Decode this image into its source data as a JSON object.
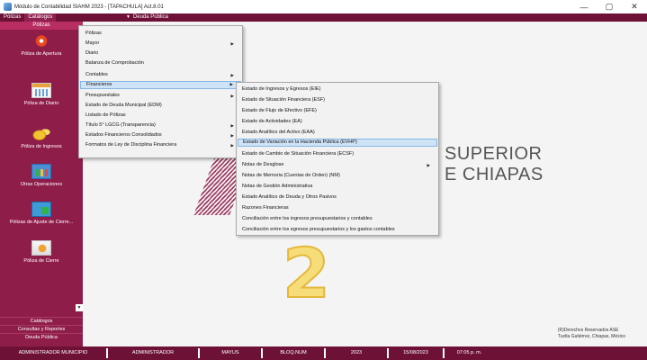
{
  "window": {
    "title": "Módulo de Contabilidad SIAHM 2023 - [TAPACHULA] Act.8.01",
    "controls": [
      "—",
      "▢",
      "✕"
    ]
  },
  "menubar": {
    "items": [
      "Pólizas",
      "Catálogos"
    ],
    "deuda_publica": "Deuda Pública"
  },
  "sidebar": {
    "header": "Pólizas",
    "items": [
      {
        "label": "Póliza de Apertura",
        "icon": "apertura-icon"
      },
      {
        "label": "Póliza de Diario",
        "icon": "calendar-icon"
      },
      {
        "label": "Póliza de Ingresos",
        "icon": "coins-icon"
      },
      {
        "label": "Otras Operaciones",
        "icon": "chart-icon"
      },
      {
        "label": "Pólizas de Ajuste de Cierre...",
        "icon": "adjust-icon"
      },
      {
        "label": "Póliza de Cierre",
        "icon": "close-book-icon"
      }
    ],
    "footer": [
      "Catálogos",
      "Consultas y Reportes",
      "Deuda Pública"
    ]
  },
  "menu_reports": {
    "items": [
      {
        "label": "Pólizas",
        "submenu": false
      },
      {
        "label": "Mayor",
        "submenu": true
      },
      {
        "label": "Diario",
        "submenu": false
      },
      {
        "label": "Balanza de Comprobación",
        "submenu": false
      },
      {
        "label": "Contables",
        "submenu": true
      },
      {
        "label": "Financieros",
        "submenu": true,
        "highlighted": true
      },
      {
        "label": "Presupuestales",
        "submenu": true
      },
      {
        "label": "Estado de Deuda Municipal (EDM)",
        "submenu": false
      },
      {
        "label": "Listado de Pólizas",
        "submenu": false
      },
      {
        "label": "Título 5° LGCG (Transparencia)",
        "submenu": true
      },
      {
        "label": "Estados Financieros Consolidados",
        "submenu": true
      },
      {
        "label": "Formatos de Ley de Disciplina Financiera",
        "submenu": true
      }
    ]
  },
  "menu_financieros": {
    "items": [
      {
        "label": "Estado de Ingresos y Egresos (EIE)",
        "submenu": false
      },
      {
        "label": "Estado de Situación Financiera (ESF)",
        "submenu": false
      },
      {
        "label": "Estado de Flujo de Efectivo (EFE)",
        "submenu": false
      },
      {
        "label": "Estado de Actividades (EA)",
        "submenu": false
      },
      {
        "label": "Estado Analítico del Activo (EAA)",
        "submenu": false
      },
      {
        "label": "Estado de Variación en la Hacienda Pública (EVHP)",
        "submenu": false,
        "highlighted": true
      },
      {
        "label": "Estado de Cambio de Situación Financiera (ECSF)",
        "submenu": false
      },
      {
        "label": "Notas de Desglose",
        "submenu": true
      },
      {
        "label": "Notas de Memoria (Cuentas de Orden) (NM)",
        "submenu": false
      },
      {
        "label": "Notas de Gestión Administrativa",
        "submenu": false
      },
      {
        "label": "Estado Analítico de Deuda y Otros Pasivos",
        "submenu": false
      },
      {
        "label": "Razones Financieras",
        "submenu": false
      },
      {
        "label": "Conciliación entre los ingresos presupuestarios y contables",
        "submenu": false
      },
      {
        "label": "Conciliación entre los egresos presupuestarios y los gastos contables",
        "submenu": false
      }
    ]
  },
  "watermark": {
    "line1": "SUPERIOR",
    "line2": "E CHIAPAS"
  },
  "annotation": "2",
  "rights": {
    "line1": "(R)Derechos Reservados ASE",
    "line2": "Tuxtla Gutiérrez, Chiapas, México"
  },
  "statusbar": {
    "cells": [
      "ADMINISTRADOR MUNICIPIO",
      "ADMINISTRADOR",
      "MAYUS",
      "BLOQ.NUM",
      "2023",
      "15/08/2023",
      "07:05 p. m."
    ]
  },
  "colors": {
    "brand": "#6d1236",
    "sidebar": "#8f1d4a",
    "highlight": "#cfe3f7"
  }
}
